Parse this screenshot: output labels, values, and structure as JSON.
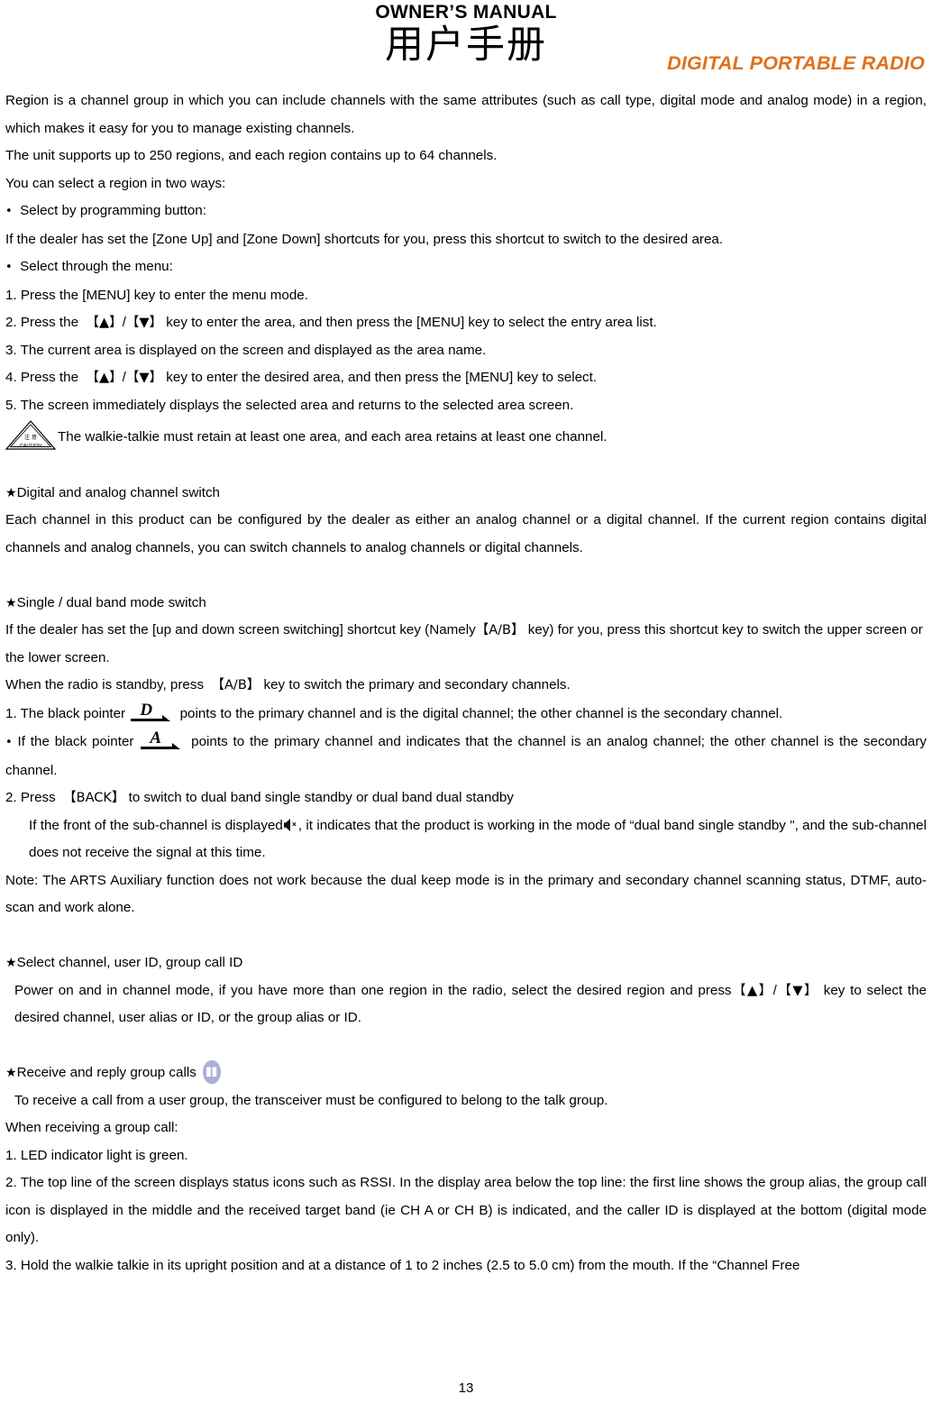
{
  "header": {
    "owners_manual": "OWNER’S MANUAL",
    "chinese_title": "用户手册",
    "product_type": "DIGITAL PORTABLE RADIO"
  },
  "colors": {
    "orange_accent": "#E0711C",
    "group_icon_fill": "#AEAFD8",
    "text": "#000000"
  },
  "body": {
    "p1": "Region is a channel group in which you can include channels with the same attributes (such as call type, digital mode and analog mode) in a region, which makes it easy for you to manage existing channels.",
    "p2": "The unit supports up to 250 regions, and each region contains up to 64 channels.",
    "p3": "You can select a region in two ways:",
    "p4_bullet": "•",
    "p4": "Select by programming button:",
    "p5": "If the dealer has set the [Zone Up] and [Zone Down] shortcuts for you, press this shortcut to switch to the desired area.",
    "p6_bullet": "•",
    "p6": "Select through the menu:",
    "p7": "1. Press the [MENU] key to enter the menu mode.",
    "p8_a": "2. Press the",
    "p8_keys_open": "【▲】",
    "p8_slash": "/",
    "p8_keys_close": "【▼】",
    "p8_b": "key to enter the area, and then press the [MENU] key to select the entry area list.",
    "p9": "3. The current area is displayed on the screen and displayed as the area name.",
    "p10_a": "4. Press the",
    "p10_b": "key to enter the desired area, and then press the [MENU] key to select.",
    "p11": "5. The screen immediately displays the selected area and returns to the selected area screen.",
    "p12": "The walkie-talkie must retain at least one area, and each area retains at least one channel.",
    "h1_star": "★",
    "h1": "Digital and analog channel switch",
    "p13": "Each channel in this product can be configured by the dealer as either an analog channel or a digital channel. If the current region contains digital channels and analog channels, you can switch channels to analog channels or digital channels.",
    "h2_star": "★",
    "h2": "Single / dual band mode switch",
    "p14_a": "If the dealer has set the [up and down screen switching] shortcut key (Namely",
    "p14_key": "【A/B】",
    "p14_b": "key) for you, press this shortcut key to switch the upper screen or the lower screen.",
    "p15_a": "When the radio is standby, press",
    "p15_key": "【A/B】",
    "p15_b": "key to switch the primary and secondary channels.",
    "p16_a": "1. The black pointer",
    "p16_icon": "D",
    "p16_b": "points to the primary channel and is the digital channel; the other channel is the secondary channel.",
    "p17_bullet": "•",
    "p17_a": "If the black pointer",
    "p17_icon": "A",
    "p17_b": "points to the primary channel and indicates that the channel is an analog channel; the other channel is the secondary channel.",
    "p18_a": "2. Press",
    "p18_key": "【BACK】",
    "p18_b": "to switch to dual band single standby or dual band dual standby",
    "p19_a": "If the front of the sub-channel is displayed",
    "p19_b": ", it indicates that the product is working in the mode of “dual band single standby \", and the sub-channel does not receive the signal at this time.",
    "p20": "Note: The ARTS Auxiliary function does not work because the dual keep mode is in the primary and secondary channel scanning status, DTMF, auto-scan and work alone.",
    "h3_star": "★",
    "h3": "Select channel, user ID, group call ID",
    "p21_a": "Power on and in channel mode, if you have more than one region in the radio, select the desired region and press",
    "p21_key_up": "【▲】",
    "p21_slash": "/",
    "p21_key_down": "【▼】",
    "p21_b": "key to select the desired channel, user alias or ID, or the group alias or ID.",
    "h4_star": "★",
    "h4": "Receive and reply group calls",
    "p22": "To receive a call from a user group, the transceiver must be configured to belong to the talk group.",
    "p23": "When receiving a group call:",
    "p24": "1. LED indicator light is green.",
    "p25": "2. The top line of the screen displays status icons such as RSSI. In the display area below the top line: the first line shows the group alias, the group call icon is displayed in the middle and the received target band (ie CH A or CH B) is indicated, and the caller ID is displayed at the bottom (digital mode only).",
    "p26": "3. Hold the walkie talkie in its upright position and at a distance of 1 to 2 inches (2.5 to 5.0 cm) from the mouth.    If the  “Channel Free"
  },
  "icons": {
    "caution_cn": "注意",
    "caution_en": "CAUTION",
    "pointer_digital": "D",
    "pointer_analog": "A",
    "mute_icon_name": "speaker-mute-icon",
    "group_call_icon_name": "group-call-icon"
  },
  "footer": {
    "page_number": "13"
  }
}
